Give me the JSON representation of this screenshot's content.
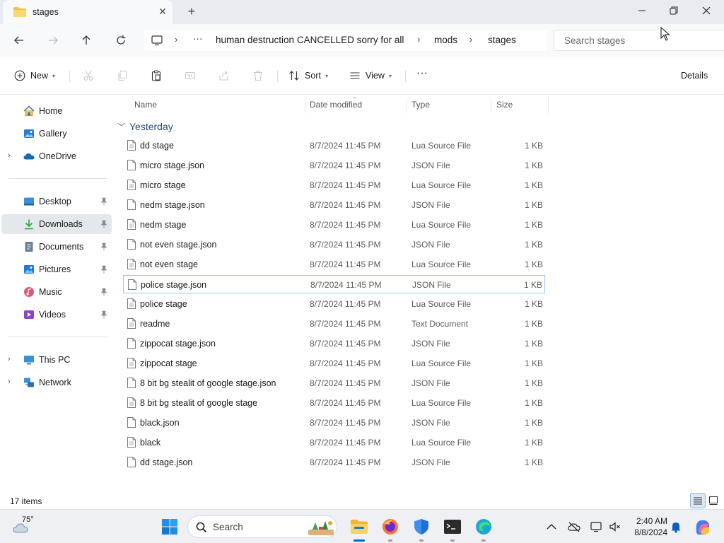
{
  "window": {
    "tab_title": "stages",
    "new_tab_symbol": "+",
    "close_tab_symbol": "✕"
  },
  "address": {
    "ellipsis": "···",
    "crumbs": [
      "human destruction CANCELLED sorry for all",
      "mods",
      "stages"
    ],
    "search_placeholder": "Search stages"
  },
  "commands": {
    "new_label": "New",
    "sort_label": "Sort",
    "view_label": "View",
    "more_label": "···",
    "details_label": "Details"
  },
  "sidebar": {
    "items": [
      {
        "label": "Home",
        "icon": "home-icon"
      },
      {
        "label": "Gallery",
        "icon": "gallery-icon"
      },
      {
        "label": "OneDrive",
        "icon": "onedrive-icon"
      },
      {
        "label": "Desktop",
        "icon": "desktop-icon"
      },
      {
        "label": "Downloads",
        "icon": "downloads-icon"
      },
      {
        "label": "Documents",
        "icon": "documents-icon"
      },
      {
        "label": "Pictures",
        "icon": "pictures-icon"
      },
      {
        "label": "Music",
        "icon": "music-icon"
      },
      {
        "label": "Videos",
        "icon": "videos-icon"
      },
      {
        "label": "This PC",
        "icon": "this-pc-icon"
      },
      {
        "label": "Network",
        "icon": "network-icon"
      }
    ]
  },
  "columns": {
    "name": "Name",
    "date": "Date modified",
    "type": "Type",
    "size": "Size"
  },
  "group": {
    "label": "Yesterday"
  },
  "files": [
    {
      "name": "dd stage",
      "date": "8/7/2024 11:45 PM",
      "type": "Lua Source File",
      "size": "1 KB"
    },
    {
      "name": "micro stage.json",
      "date": "8/7/2024 11:45 PM",
      "type": "JSON File",
      "size": "1 KB"
    },
    {
      "name": "micro stage",
      "date": "8/7/2024 11:45 PM",
      "type": "Lua Source File",
      "size": "1 KB"
    },
    {
      "name": "nedm stage.json",
      "date": "8/7/2024 11:45 PM",
      "type": "JSON File",
      "size": "1 KB"
    },
    {
      "name": "nedm stage",
      "date": "8/7/2024 11:45 PM",
      "type": "Lua Source File",
      "size": "1 KB"
    },
    {
      "name": "not even stage.json",
      "date": "8/7/2024 11:45 PM",
      "type": "JSON File",
      "size": "1 KB"
    },
    {
      "name": "not even stage",
      "date": "8/7/2024 11:45 PM",
      "type": "Lua Source File",
      "size": "1 KB"
    },
    {
      "name": "police stage.json",
      "date": "8/7/2024 11:45 PM",
      "type": "JSON File",
      "size": "1 KB"
    },
    {
      "name": "police stage",
      "date": "8/7/2024 11:45 PM",
      "type": "Lua Source File",
      "size": "1 KB"
    },
    {
      "name": "readme",
      "date": "8/7/2024 11:45 PM",
      "type": "Text Document",
      "size": "1 KB"
    },
    {
      "name": "zippocat stage.json",
      "date": "8/7/2024 11:45 PM",
      "type": "JSON File",
      "size": "1 KB"
    },
    {
      "name": "zippocat stage",
      "date": "8/7/2024 11:45 PM",
      "type": "Lua Source File",
      "size": "1 KB"
    },
    {
      "name": "8 bit bg stealit of google stage.json",
      "date": "8/7/2024 11:45 PM",
      "type": "JSON File",
      "size": "1 KB"
    },
    {
      "name": "8 bit bg stealit of google stage",
      "date": "8/7/2024 11:45 PM",
      "type": "Lua Source File",
      "size": "1 KB"
    },
    {
      "name": "black.json",
      "date": "8/7/2024 11:45 PM",
      "type": "JSON File",
      "size": "1 KB"
    },
    {
      "name": "black",
      "date": "8/7/2024 11:45 PM",
      "type": "Lua Source File",
      "size": "1 KB"
    },
    {
      "name": "dd stage.json",
      "date": "8/7/2024 11:45 PM",
      "type": "JSON File",
      "size": "1 KB"
    }
  ],
  "status": {
    "item_count": "17 items"
  },
  "taskbar": {
    "temperature": "75°",
    "search_label": "Search",
    "time": "2:40 AM",
    "date": "8/8/2024"
  },
  "colors": {
    "accent": "#0067c0",
    "selection_border": "#99c9ef",
    "folder": "#f2c14e"
  }
}
